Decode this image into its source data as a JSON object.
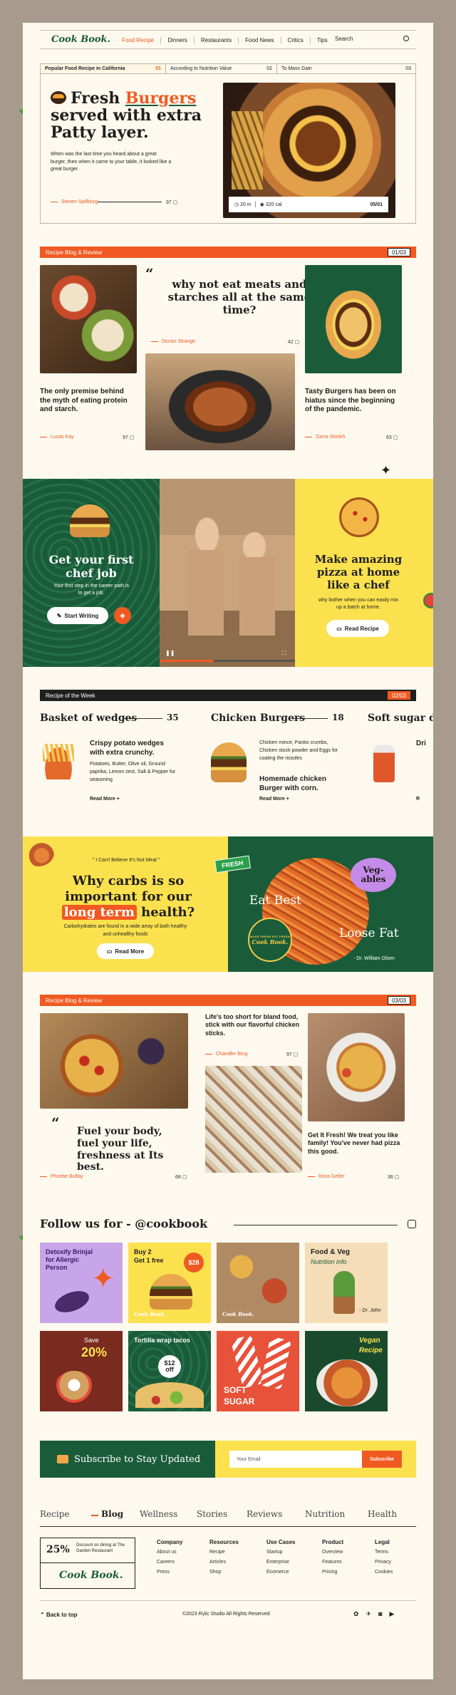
{
  "brand": {
    "logo": "Cook Book."
  },
  "nav": {
    "items": [
      "Food Recipe",
      "Dinners",
      "Restaurants",
      "Food News",
      "Critics",
      "Tips"
    ],
    "active": "Food Recipe",
    "search": "Search"
  },
  "hero": {
    "tabs": [
      {
        "label": "Popular Food Recipe in California",
        "num": "01"
      },
      {
        "label": "According to Nutrition Value",
        "num": "02"
      },
      {
        "label": "To Mass Gain",
        "num": "03"
      }
    ],
    "title_a": "Fresh ",
    "title_b": "Burgers",
    "title_c": "served with extra Patty layer.",
    "desc": "When was the last time you heard about a great burger, then when it came to your table, it looked like a great burger.",
    "author": "Steven Spillburg",
    "comments": "97",
    "time": "20 m",
    "cal": "320 cal",
    "slide": "05/01"
  },
  "blog1": {
    "bar_label": "Recipe Blog & Review",
    "bar_count": "01/03",
    "quote": "why not eat meats and starches all at the same time?",
    "quote_author": "Doctor Strange",
    "quote_comments": "42",
    "left_title": "The only premise behind the myth of eating protein and starch.",
    "left_author": "Lucas Kay",
    "left_comments": "97",
    "right_title": "Tasty Burgers has been on hiatus since the beginning of the pandemic.",
    "right_author": "Zamir Sheikh",
    "right_comments": "63"
  },
  "promo": {
    "left_title": "Get your first chef job",
    "left_desc": "Your first step in the career path is to get a job.",
    "left_button": "Start Writing",
    "right_title": "Make amazing pizza at home like a chef",
    "right_desc": "why bother when you can easily mix up a batch at home.",
    "right_button": "Read Recipe"
  },
  "week": {
    "bar_label": "Recipe of the Week",
    "bar_count": "02/03",
    "items": [
      {
        "name": "Basket of wedges",
        "num": "35",
        "sub": "Crispy potato wedges with extra crunchy.",
        "ingredients": "Potatoes, Butter, Olive oil, Ground paprika, Lemon zest, Salt & Pepper for seasoning",
        "more": "Read More"
      },
      {
        "name": "Chicken Burgers",
        "num": "18",
        "sub": "Homemade chicken Burger with corn.",
        "ingredients": "Chicken mince, Panko crumbs, Chicken stock powder and Eggs for coating the rissoles",
        "more": "Read More"
      },
      {
        "name": "Soft sugar dr",
        "num": "",
        "sub": "Dri",
        "ingredients": "",
        "more": "R"
      }
    ]
  },
  "carbs": {
    "quote": "\" I Can't Believe It's Not Meal \"",
    "title_a": "Why carbs is so important  for our",
    "title_b": "long term",
    "title_c": " health?",
    "desc": "Carbohydrates are found in a wide array of both healthy and unhealthy foods",
    "button": "Read More",
    "badge": "FRESH",
    "eat_best": "Eat Best",
    "lose_fat": "Loose Fat",
    "vegtables": "Veg-ables",
    "seal": "MAKE FRESH EAT FRESH",
    "seal_logo": "Cook Book.",
    "credit": "- Dr. William Olsen"
  },
  "blog3": {
    "bar_label": "Recipe Blog & Review",
    "bar_count": "03/03",
    "mid_title": "Life's too short for bland food, stick with our flavorful chicken sticks.",
    "mid_author": "Chandler Bing",
    "mid_comments": "97",
    "quote": "Fuel your body, fuel your life, freshness at Its best.",
    "quote_author": "Phoebe Buffay",
    "quote_comments": "68",
    "right_title": "Get It Fresh! We treat you like family! You've never had pizza this good.",
    "right_author": "Ross Geller",
    "right_comments": "36"
  },
  "social": {
    "heading": "Follow us for - @cookbook",
    "t1": "Detoxify Brinjal for Allergic Person",
    "t2a": "Buy 2",
    "t2b": "Get 1 free",
    "t2c": "$28",
    "t4a": "Food & Veg",
    "t4b": "Nutrition info",
    "t4c": "- Dr. John",
    "t5a": "Save",
    "t5b": "20%",
    "t6a": "Tortilla wrap tacos",
    "t6b": "$12",
    "t6c": "off",
    "t7a": "SOFT",
    "t7b": "SUGAR",
    "t8a": "Vegan",
    "t8b": "Recipe",
    "mini_logo": "Cook Book."
  },
  "subscribe": {
    "title": "Subscribe to Stay Updated",
    "placeholder": "Your Email",
    "button": "Subscribe"
  },
  "footer": {
    "tabs": [
      "Recipe",
      "Blog",
      "Wellness",
      "Stories",
      "Reviews",
      "Nutrition",
      "Health"
    ],
    "active": "Blog",
    "discount": "25%",
    "discount_text": "Discount on dining at The Garden Restaurant",
    "cols": [
      {
        "h": "Company",
        "items": [
          "About us",
          "Careers",
          "Press"
        ]
      },
      {
        "h": "Resources",
        "items": [
          "Recipe",
          "Articles",
          "Shop"
        ]
      },
      {
        "h": "Use Cases",
        "items": [
          "Startup",
          "Enterprise",
          "Ecomerce"
        ]
      },
      {
        "h": "Product",
        "items": [
          "Overview",
          "Features",
          "Pricing"
        ]
      },
      {
        "h": "Legal",
        "items": [
          "Terms",
          "Privacy",
          "Cookies"
        ]
      }
    ],
    "back": "Back to top",
    "copyright": "©2023 Rylic Studio All Rights Reserved"
  }
}
